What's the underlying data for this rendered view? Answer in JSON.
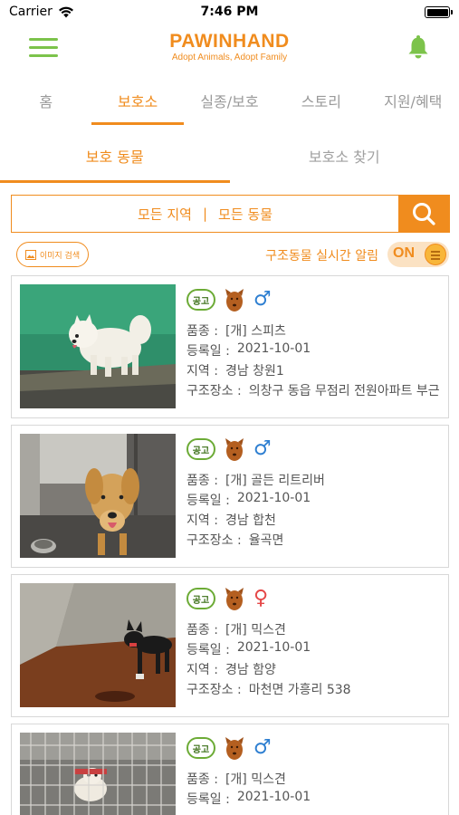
{
  "status_bar": {
    "carrier": "Carrier",
    "time": "7:46 PM",
    "battery_level": 1.0
  },
  "header": {
    "logo_title": "PAWINHAND",
    "logo_subtitle": "Adopt Animals, Adopt Family",
    "menu_icon": "hamburger-menu-icon",
    "bell_icon": "bell-icon"
  },
  "main_tabs": [
    {
      "label": "홈",
      "active": false
    },
    {
      "label": "보호소",
      "active": true
    },
    {
      "label": "실종/보호",
      "active": false
    },
    {
      "label": "스토리",
      "active": false
    },
    {
      "label": "지원/혜택",
      "active": false
    }
  ],
  "sub_tabs": [
    {
      "label": "보호 동물",
      "active": true
    },
    {
      "label": "보호소 찾기",
      "active": false
    }
  ],
  "search": {
    "region": "모든 지역",
    "separator": "|",
    "animal": "모든 동물",
    "icon": "search-icon"
  },
  "tools": {
    "image_search_label": "이미지 검색",
    "alert_label": "구조동물 실시간 알림",
    "toggle_label": "ON",
    "toggle_on": true
  },
  "colors": {
    "accent": "#f08c1e",
    "green": "#7cc34b",
    "male": "#2e7fd1",
    "female": "#e54747"
  },
  "listings": [
    {
      "badge": "공고",
      "gender": "male",
      "gender_symbol": "♂",
      "photo": "white-spitz-dog-photo",
      "rows": [
        {
          "key": "품종 :",
          "value": "[개] 스피츠"
        },
        {
          "key": "등록일 :",
          "value": "2021-10-01"
        },
        {
          "key": "지역 :",
          "value": "경남 창원1"
        },
        {
          "key": "구조장소 :",
          "value": "의창구 동읍 무점리 전원아파트 부근"
        }
      ]
    },
    {
      "badge": "공고",
      "gender": "male",
      "gender_symbol": "♂",
      "photo": "golden-retriever-photo",
      "rows": [
        {
          "key": "품종 :",
          "value": "[개] 골든 리트리버"
        },
        {
          "key": "등록일 :",
          "value": "2021-10-01"
        },
        {
          "key": "지역 :",
          "value": "경남 합천"
        },
        {
          "key": "구조장소 :",
          "value": "율곡면"
        }
      ]
    },
    {
      "badge": "공고",
      "gender": "female",
      "gender_symbol": "♀",
      "photo": "black-mixed-dog-photo",
      "rows": [
        {
          "key": "품종 :",
          "value": "[개] 믹스견"
        },
        {
          "key": "등록일 :",
          "value": "2021-10-01"
        },
        {
          "key": "지역 :",
          "value": "경남 함양"
        },
        {
          "key": "구조장소 :",
          "value": "마천면 가흥리 538"
        }
      ]
    },
    {
      "badge": "공고",
      "gender": "male",
      "gender_symbol": "♂",
      "photo": "caged-mixed-dog-photo",
      "rows": [
        {
          "key": "품종 :",
          "value": "[개] 믹스견"
        },
        {
          "key": "등록일 :",
          "value": "2021-10-01"
        }
      ]
    }
  ]
}
